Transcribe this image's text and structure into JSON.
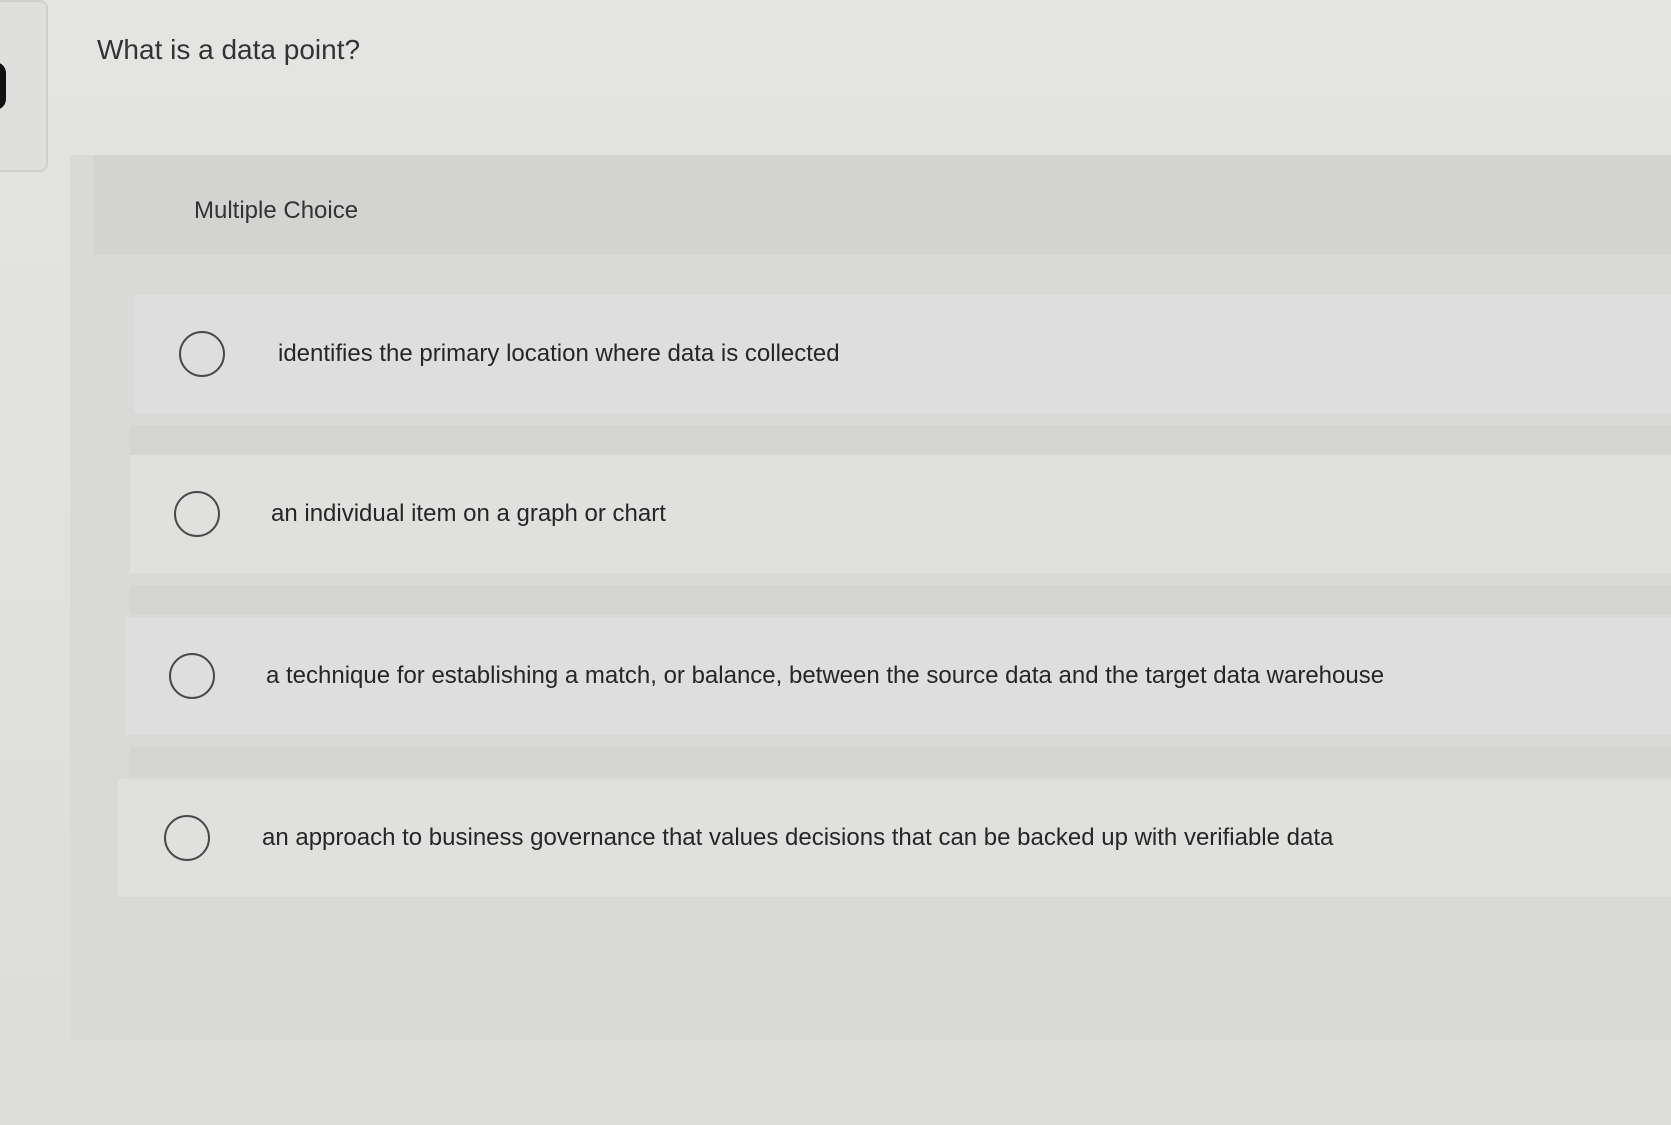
{
  "question": {
    "title": "What is a data point?"
  },
  "card": {
    "header_label": "Multiple Choice"
  },
  "options": [
    {
      "label": "identifies the primary location where data is collected",
      "selected": false
    },
    {
      "label": "an individual item on a graph or chart",
      "selected": false
    },
    {
      "label": "a technique for establishing a match, or balance, between the source data and the target data warehouse",
      "selected": false
    },
    {
      "label": "an approach to business governance that values decisions that can be backed up with verifiable data",
      "selected": false
    }
  ]
}
